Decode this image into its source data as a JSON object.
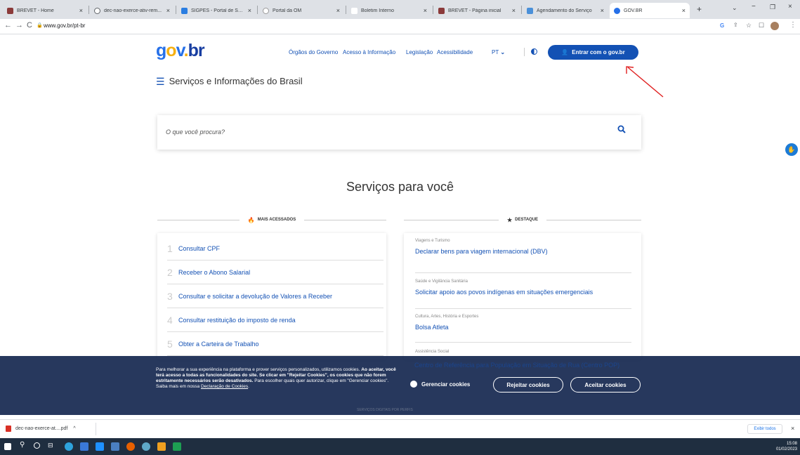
{
  "browser": {
    "tabs": [
      {
        "title": "BREVET - Home",
        "color": "#8b3a3a"
      },
      {
        "title": "dec-nao-exerce-ativ-rem...",
        "color": "#5f6368"
      },
      {
        "title": "SIGPES - Portal de Serviço",
        "color": "#2a7de1"
      },
      {
        "title": "Portal da OM",
        "color": "#999999"
      },
      {
        "title": "Boletim Interno",
        "color": "#cccccc"
      },
      {
        "title": "BREVET - Página inicial",
        "color": "#8b3a3a"
      },
      {
        "title": "Agendamento do Serviço",
        "color": "#4a90d9"
      },
      {
        "title": "GOV.BR",
        "color": "#2670e8"
      }
    ],
    "url": "www.gov.br/pt-br"
  },
  "header": {
    "logo": {
      "g": "g",
      "o": "o",
      "v": "v",
      "dot": ".",
      "br": "br"
    },
    "links": [
      "Órgãos do Governo",
      "Acesso à Informação",
      "Legislação",
      "Acessibilidade"
    ],
    "lang": "PT",
    "login_label": "Entrar com o gov.br",
    "menu_title": "Serviços e Informações do Brasil"
  },
  "search": {
    "placeholder": "O que você procura?"
  },
  "section_title": "Serviços para você",
  "mais_acessados": {
    "label": "MAIS ACESSADOS",
    "items": [
      {
        "n": "1",
        "label": "Consultar CPF"
      },
      {
        "n": "2",
        "label": "Receber o Abono Salarial"
      },
      {
        "n": "3",
        "label": "Consultar e solicitar a devolução de Valores a Receber"
      },
      {
        "n": "4",
        "label": "Consultar restituição do imposto de renda"
      },
      {
        "n": "5",
        "label": "Obter a Carteira de Trabalho"
      }
    ]
  },
  "destaque": {
    "label": "DESTAQUE",
    "items": [
      {
        "cat": "Viagens e Turismo",
        "label": "Declarar bens para viagem internacional (DBV)"
      },
      {
        "cat": "Saúde e Vigilância Sanitária",
        "label": "Solicitar apoio aos povos indígenas em situações emergenciais"
      },
      {
        "cat": "Cultura, Artes, História e Esportes",
        "label": "Bolsa Atleta"
      },
      {
        "cat": "Assistência Social",
        "label": "Centro de Referência para População em Situação de Rua (Centro POP)"
      }
    ]
  },
  "cookie": {
    "t1": "Para melhorar a sua experiência na plataforma e prover serviços personalizados, utilizamos cookies. ",
    "t2": "Ao aceitar, você terá acesso a todas as funcionalidades do site. Se clicar em \"Rejeitar Cookies\", os cookies que não forem estritamente necessários serão desativados.",
    "t3": " Para escolher quais quer autorizar, clique em \"Gerenciar cookies\". Saiba mais em nossa ",
    "link": "Declaração de Cookies",
    "t4": ".",
    "manage": "Gerenciar cookies",
    "reject": "Rejeitar cookies",
    "accept": "Aceitar cookies"
  },
  "behind_banner": "SERVIÇOS DIGITAIS POR PERFIS",
  "downloads": {
    "file": "dec-nao-exerce-at....pdf",
    "show_all": "Exibir todos"
  },
  "clock": {
    "time": "15:08",
    "date": "01/02/2023"
  }
}
